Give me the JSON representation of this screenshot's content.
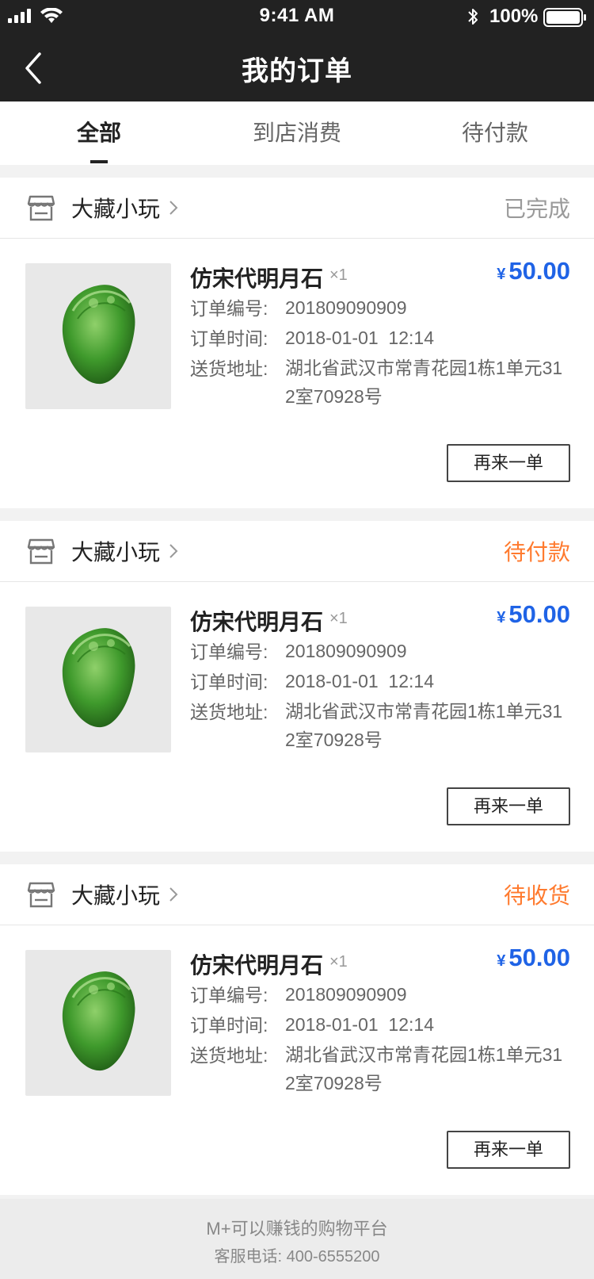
{
  "status_bar": {
    "time": "9:41 AM",
    "battery_percent": "100%"
  },
  "nav": {
    "title": "我的订单"
  },
  "tabs": [
    {
      "label": "全部",
      "active": true
    },
    {
      "label": "到店消费",
      "active": false
    },
    {
      "label": "待付款",
      "active": false
    }
  ],
  "orders": [
    {
      "shop_name": "大藏小玩",
      "status": "已完成",
      "status_color": "#9a9a9a",
      "product_name": "仿宋代明月石",
      "quantity": "×1",
      "price_symbol": "¥",
      "price": "50.00",
      "order_no_label": "订单编号:",
      "order_no": "201809090909",
      "order_time_label": "订单时间:",
      "order_time": "2018-01-01  12:14",
      "address_label": "送货地址:",
      "address": "湖北省武汉市常青花园1栋1单元312室70928号",
      "button_label": "再来一单"
    },
    {
      "shop_name": "大藏小玩",
      "status": "待付款",
      "status_color": "#ff7a2e",
      "product_name": "仿宋代明月石",
      "quantity": "×1",
      "price_symbol": "¥",
      "price": "50.00",
      "order_no_label": "订单编号:",
      "order_no": "201809090909",
      "order_time_label": "订单时间:",
      "order_time": "2018-01-01  12:14",
      "address_label": "送货地址:",
      "address": "湖北省武汉市常青花园1栋1单元312室70928号",
      "button_label": "再来一单"
    },
    {
      "shop_name": "大藏小玩",
      "status": "待收货",
      "status_color": "#ff7a2e",
      "product_name": "仿宋代明月石",
      "quantity": "×1",
      "price_symbol": "¥",
      "price": "50.00",
      "order_no_label": "订单编号:",
      "order_no": "201809090909",
      "order_time_label": "订单时间:",
      "order_time": "2018-01-01  12:14",
      "address_label": "送货地址:",
      "address": "湖北省武汉市常青花园1栋1单元312室70928号",
      "button_label": "再来一单"
    }
  ],
  "footer": {
    "slogan": "M+可以赚钱的购物平台",
    "hotline": "客服电话: 400-6555200"
  },
  "colors": {
    "header_bg": "#222222",
    "price": "#1f63e6",
    "status_orange": "#ff7a2e",
    "status_grey": "#9a9a9a"
  },
  "icons": {
    "back": "chevron-left-icon",
    "shop": "store-icon",
    "shop_chevron": "chevron-right-icon"
  }
}
